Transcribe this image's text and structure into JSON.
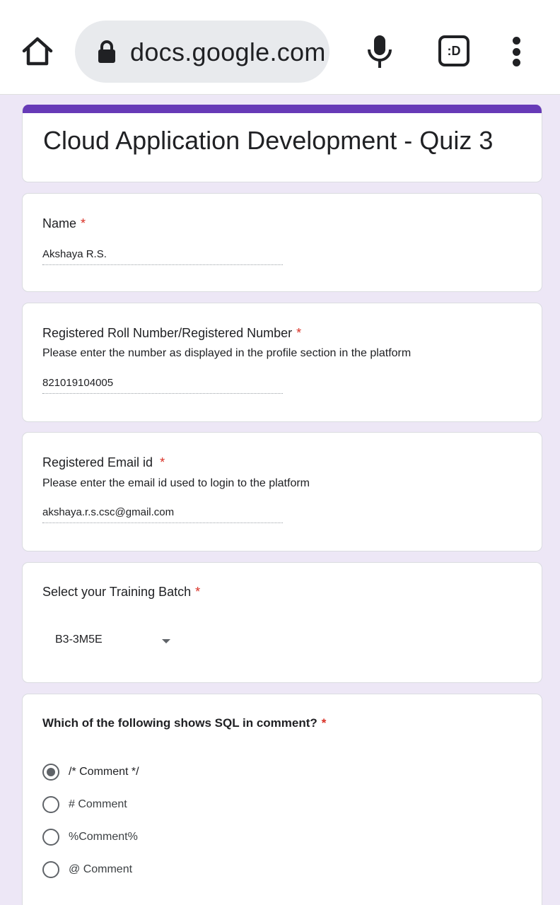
{
  "browser": {
    "url": "docs.google.com",
    "tab_label": ":D"
  },
  "form": {
    "title": "Cloud Application Development - Quiz 3"
  },
  "questions": {
    "name": {
      "label": "Name",
      "required_mark": "*",
      "value": "Akshaya R.S."
    },
    "roll": {
      "label": "Registered Roll Number/Registered Number",
      "required_mark": "*",
      "help": "Please enter the number as displayed in the profile section in the platform",
      "value": "821019104005"
    },
    "email": {
      "label": "Registered Email id",
      "required_mark": "*",
      "help": "Please enter the email id used to login to the platform",
      "value": "akshaya.r.s.csc@gmail.com"
    },
    "batch": {
      "label": "Select your Training Batch",
      "required_mark": "*",
      "selected": "B3-3M5E"
    },
    "sql": {
      "label": "Which of the following shows SQL in comment?",
      "required_mark": "*",
      "options": [
        {
          "label": "/* Comment */",
          "checked": true
        },
        {
          "label": "# Comment",
          "checked": false
        },
        {
          "label": "%Comment%",
          "checked": false
        },
        {
          "label": "@ Comment",
          "checked": false
        }
      ]
    }
  },
  "colors": {
    "accent": "#673ab7",
    "background": "#ede7f6",
    "required": "#d93025"
  }
}
